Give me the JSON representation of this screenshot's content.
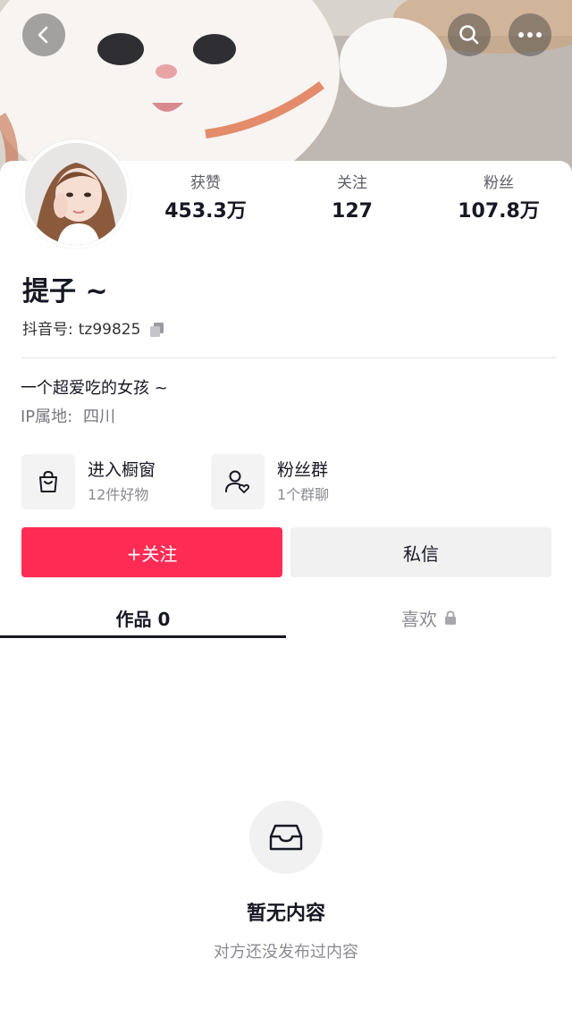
{
  "header": {
    "back_icon": "chevron-left-icon",
    "search_icon": "search-icon",
    "more_icon": "ellipsis-icon"
  },
  "profile": {
    "name": "提子 ~",
    "account_label": "抖音号:",
    "account_id": "tz99825",
    "bio": "一个超爱吃的女孩 ~",
    "ip_label": "IP属地:",
    "ip_location": "四川"
  },
  "stats": [
    {
      "label": "获赞",
      "value": "453.3万"
    },
    {
      "label": "关注",
      "value": "127"
    },
    {
      "label": "粉丝",
      "value": "107.8万"
    }
  ],
  "features": [
    {
      "title": "进入橱窗",
      "subtitle": "12件好物",
      "icon": "shopping-bag-icon"
    },
    {
      "title": "粉丝群",
      "subtitle": "1个群聊",
      "icon": "fan-group-icon"
    }
  ],
  "actions": {
    "follow_label": "+关注",
    "message_label": "私信"
  },
  "tabs": [
    {
      "label": "作品 0",
      "active": true
    },
    {
      "label": "喜欢",
      "active": false,
      "icon": "lock-icon"
    }
  ],
  "empty_state": {
    "icon": "inbox-tray-icon",
    "title": "暂无内容",
    "subtitle": "对方还没发布过内容"
  },
  "colors": {
    "accent": "#fe2c55",
    "text_primary": "#161823",
    "text_secondary": "#8a8b91",
    "button_secondary_bg": "#f1f1f2"
  }
}
